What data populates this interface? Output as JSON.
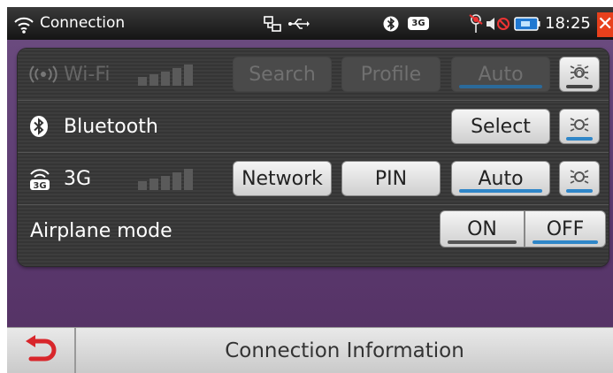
{
  "status": {
    "title": "Connection",
    "time": "18:25",
    "icons": [
      "wifi-signal-icon",
      "network-icon",
      "usb-icon",
      "bluetooth-icon",
      "3g-icon",
      "alarm-off-icon",
      "mute-icon",
      "battery-icon",
      "close-icon"
    ],
    "badge_3g": "3G"
  },
  "rows": {
    "wifi": {
      "label": "Wi-Fi",
      "search": "Search",
      "profile": "Profile",
      "auto": "Auto"
    },
    "bluetooth": {
      "label": "Bluetooth",
      "select": "Select"
    },
    "g3": {
      "label": "3G",
      "badge": "3G",
      "network": "Network",
      "pin": "PIN",
      "auto": "Auto"
    },
    "airplane": {
      "label": "Airplane mode",
      "on": "ON",
      "off": "OFF"
    }
  },
  "bottom": {
    "title": "Connection Information"
  },
  "colors": {
    "accent": "#2f86c8",
    "background": "#5b3c6e",
    "close": "#e8401c"
  }
}
